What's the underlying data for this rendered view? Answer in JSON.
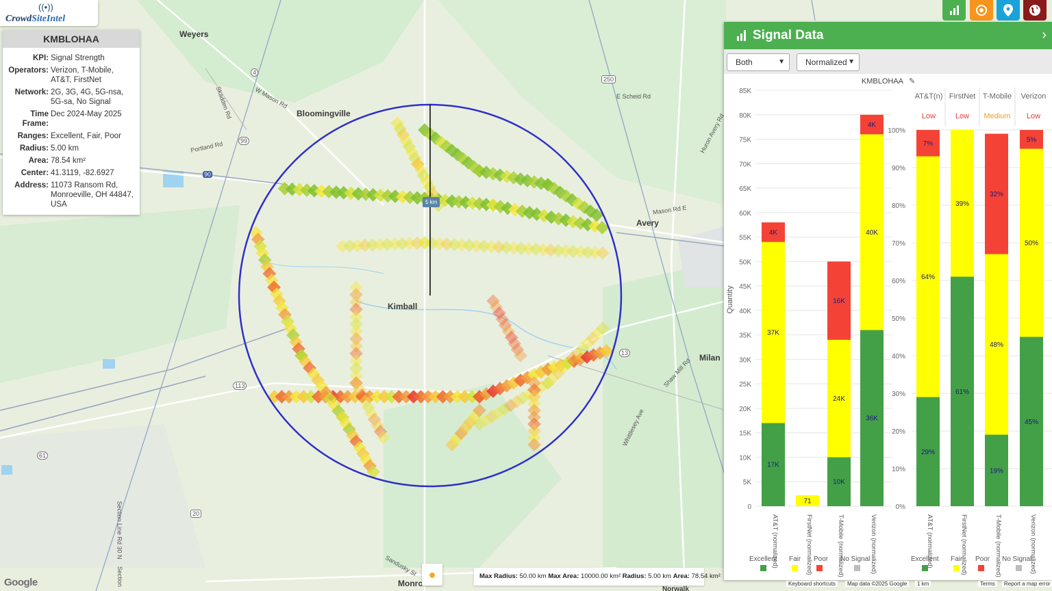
{
  "logo": {
    "prefix": "Crowd",
    "suffix": "SiteIntel"
  },
  "info": {
    "title": "KMBLOHAA",
    "rows": [
      {
        "k": "KPI:",
        "v": "Signal Strength"
      },
      {
        "k": "Operators:",
        "v": "Verizon, T-Mobile, AT&T, FirstNet"
      },
      {
        "k": "Network:",
        "v": "2G, 3G, 4G, 5G-nsa, 5G-sa, No Signal"
      },
      {
        "k": "Time Frame:",
        "v": "Dec 2024-May 2025"
      },
      {
        "k": "Ranges:",
        "v": "Excellent, Fair, Poor"
      },
      {
        "k": "Radius:",
        "v": "5.00 km"
      },
      {
        "k": "Area:",
        "v": "78.54 km²"
      },
      {
        "k": "Center:",
        "v": "41.3119, -82.6927"
      },
      {
        "k": "Address:",
        "v": "11073 Ransom Rd, Monroeville, OH 44847, USA"
      }
    ]
  },
  "map": {
    "towns": [
      "Weyers",
      "Bloomingville",
      "Kimball",
      "Avery",
      "Milan",
      "Monro",
      "Norwalk"
    ],
    "roads": [
      "W Mason Rd",
      "Portland Rd",
      "Skadden Rd",
      "E Scheid Rd",
      "Huron Avery Rd",
      "Mason Rd E",
      "Shaw Mill Rd",
      "Whittlesey Ave",
      "Sandusky St",
      "Section Line Rd 30 N",
      "Section"
    ],
    "route_shields": [
      "4",
      "99",
      "250",
      "90",
      "20",
      "113",
      "13",
      "61"
    ],
    "radius_label": "5 km",
    "circle_color": "#2f2fc8"
  },
  "buttons": {
    "chart_color": "#4caf50",
    "target_color": "#f7941d",
    "pin_color": "#1aa3d9",
    "globe_color": "#8b1a1a"
  },
  "panel": {
    "title": "Signal Data",
    "select_type": "Both",
    "select_mode": "Normalized",
    "chart_title": "KMBLOHAA"
  },
  "chart_data": [
    {
      "type": "bar",
      "stacked": true,
      "title": "KMBLOHAA",
      "ylabel": "Quantity",
      "ylim": [
        0,
        85000
      ],
      "yticks": [
        "0",
        "5K",
        "10K",
        "15K",
        "20K",
        "25K",
        "30K",
        "35K",
        "40K",
        "45K",
        "50K",
        "55K",
        "60K",
        "65K",
        "70K",
        "75K",
        "80K",
        "85K"
      ],
      "categories": [
        "AT&T (normalized)",
        "FirstNet (normalized)",
        "T-Mobile (normalized)",
        "Verizon (normalized)"
      ],
      "series": [
        {
          "name": "Excellent",
          "color": "#43a047",
          "values": [
            17000,
            0,
            10000,
            36000
          ],
          "labels": [
            "17K",
            "",
            "10K",
            "36K"
          ]
        },
        {
          "name": "Fair",
          "color": "#ffff00",
          "values": [
            37000,
            71,
            24000,
            40000
          ],
          "labels": [
            "37K",
            "71",
            "24K",
            "40K"
          ]
        },
        {
          "name": "Poor",
          "color": "#f44336",
          "values": [
            4000,
            0,
            16000,
            4000
          ],
          "labels": [
            "4K",
            "",
            "16K",
            "4K"
          ]
        },
        {
          "name": "No Signal",
          "color": "#bdbdbd",
          "values": [
            0,
            0,
            0,
            0
          ],
          "labels": [
            "",
            "",
            "",
            ""
          ]
        }
      ]
    },
    {
      "type": "bar",
      "stacked": true,
      "percent": true,
      "ylim": [
        0,
        100
      ],
      "yticks": [
        "0%",
        "10%",
        "20%",
        "30%",
        "40%",
        "50%",
        "60%",
        "70%",
        "80%",
        "90%",
        "100%"
      ],
      "headers": [
        "AT&T(n)",
        "FirstNet",
        "T-Mobile",
        "Verizon"
      ],
      "ratings": [
        "Low",
        "Low",
        "Medium",
        "Low"
      ],
      "categories": [
        "AT&T (normalized)",
        "FirstNet (normalized)",
        "T-Mobile (normalized)",
        "Verizon (normalized)"
      ],
      "series": [
        {
          "name": "Excellent",
          "color": "#43a047",
          "values": [
            29,
            61,
            19,
            45
          ],
          "labels": [
            "29%",
            "61%",
            "19%",
            "45%"
          ]
        },
        {
          "name": "Fair",
          "color": "#ffff00",
          "values": [
            64,
            39,
            48,
            50
          ],
          "labels": [
            "64%",
            "39%",
            "48%",
            "50%"
          ]
        },
        {
          "name": "Poor",
          "color": "#f44336",
          "values": [
            7,
            0,
            32,
            5
          ],
          "labels": [
            "7%",
            "",
            "32%",
            "5%"
          ]
        },
        {
          "name": "No Signal",
          "color": "#bdbdbd",
          "values": [
            0,
            0,
            0,
            0
          ],
          "labels": [
            "",
            "",
            "",
            ""
          ]
        }
      ]
    }
  ],
  "footer": {
    "google": "Google",
    "stats": [
      {
        "k": "Max Radius:",
        "v": "50.00 km"
      },
      {
        "k": "Max Area:",
        "v": "10000.00 km²"
      },
      {
        "k": "Radius:",
        "v": "5.00 km"
      },
      {
        "k": "Area:",
        "v": "78.54 km²"
      }
    ],
    "shortcuts": "Keyboard shortcuts",
    "mapdata": "Map data ©2025 Google",
    "scale": "1 km",
    "terms": "Terms",
    "report": "Report a map error"
  }
}
